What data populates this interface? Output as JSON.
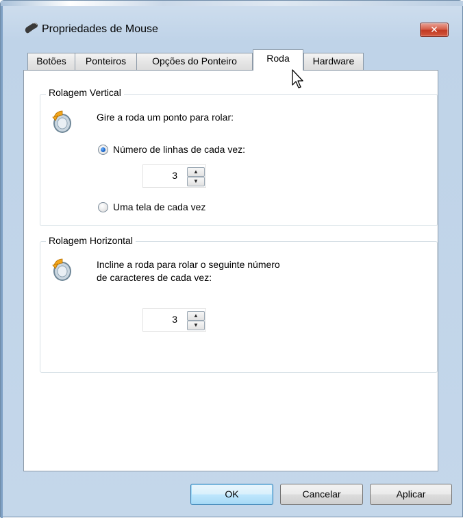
{
  "window": {
    "title": "Propriedades de Mouse",
    "close_label": "✕"
  },
  "tabs": [
    {
      "label": "Botões"
    },
    {
      "label": "Ponteiros"
    },
    {
      "label": "Opções do Ponteiro"
    },
    {
      "label": "Roda",
      "active": true
    },
    {
      "label": "Hardware"
    }
  ],
  "vertical": {
    "title": "Rolagem Vertical",
    "instruction": "Gire a roda um ponto para rolar:",
    "option_lines": "Número de linhas de cada vez:",
    "lines_value": "3",
    "option_screen": "Uma tela de cada vez",
    "selected": "lines"
  },
  "horizontal": {
    "title": "Rolagem Horizontal",
    "instruction_line1": "Incline a roda para rolar o seguinte número",
    "instruction_line2": "de caracteres de cada vez:",
    "chars_value": "3"
  },
  "buttons": {
    "ok": "OK",
    "cancel": "Cancelar",
    "apply": "Aplicar"
  },
  "colors": {
    "accent": "#1a64c8",
    "close": "#c23a22"
  },
  "icons": [
    "mouse-icon",
    "close-icon",
    "mouse-wheel-icon",
    "arrow-up-icon",
    "arrow-down-icon",
    "cursor-icon"
  ]
}
